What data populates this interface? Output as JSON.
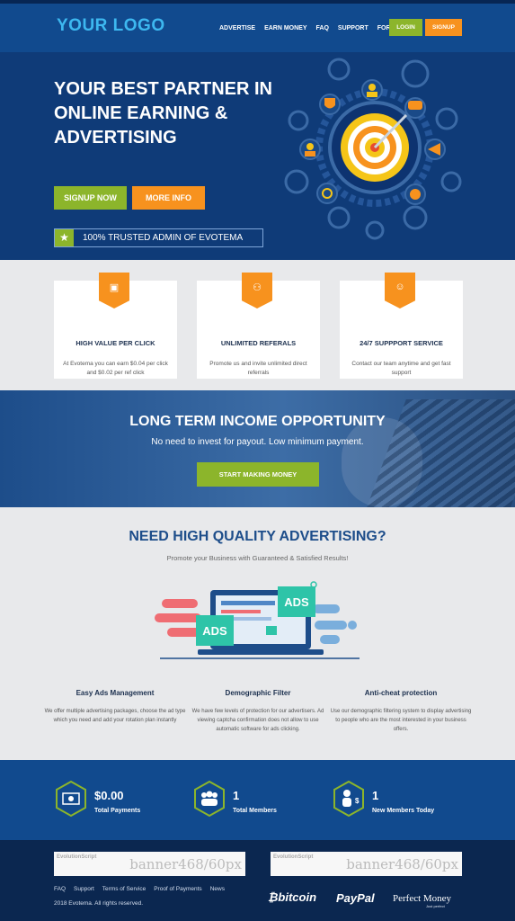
{
  "header": {
    "logo": "YOUR LOGO",
    "nav": [
      "ADVERTISE",
      "EARN MONEY",
      "FAQ",
      "SUPPORT",
      "FORUM"
    ],
    "login": "LOGIN",
    "signup": "SIGNUP"
  },
  "hero": {
    "title": "YOUR BEST PARTNER IN ONLINE EARNING & ADVERTISING",
    "signup_now": "SIGNUP NOW",
    "more_info": "MORE INFO",
    "trusted": "100% TRUSTED ADMIN OF EVOTEMA"
  },
  "features": [
    {
      "icon": "money-icon",
      "title": "HIGH VALUE PER CLICK",
      "desc": "At Evotema you can earn $0.04 per click and $0.02 per ref click"
    },
    {
      "icon": "group-icon",
      "title": "UNLIMITED REFERALS",
      "desc": "Promote us and invite unlimited direct referrals"
    },
    {
      "icon": "support-icon",
      "title": "24/7 SUPPPORT SERVICE",
      "desc": "Contact our team anytime and get fast support"
    }
  ],
  "income": {
    "title": "LONG TERM INCOME OPPORTUNITY",
    "subtitle": "No need to invest for payout. Low minimum payment.",
    "button": "START MAKING MONEY"
  },
  "advertising": {
    "title": "NEED HIGH QUALITY ADVERTISING?",
    "subtitle": "Promote your Business with Guaranteed & Satisfied Results!",
    "ads_label": "ADS",
    "columns": [
      {
        "title": "Easy Ads Management",
        "desc": "We offer multiple advertising packages, choose the ad type which you need and add your rotation plan instantly"
      },
      {
        "title": "Demographic Filter",
        "desc": "We have few levels of protection for our advertisers. Ad viewing captcha confirmation does not allow to use automatic software for ads clicking."
      },
      {
        "title": "Anti-cheat protection",
        "desc": "Use our demographic filtering system to display advertising to people who are the most interested in your business offers."
      }
    ]
  },
  "stats": [
    {
      "icon": "payments-icon",
      "value": "$0.00",
      "label": "Total Payments"
    },
    {
      "icon": "members-icon",
      "value": "1",
      "label": "Total Members"
    },
    {
      "icon": "new-member-icon",
      "value": "1",
      "label": "New Members Today"
    }
  ],
  "footer": {
    "banner_script": "EvolutionScript",
    "banner_size": "banner468/60px",
    "links": [
      "FAQ",
      "Support",
      "Terms of Service",
      "Proof of Payments",
      "News"
    ],
    "copyright": "2018 Evotema. All rights reserved.",
    "bitcoin": "bitcoin",
    "paypal": "PayPal",
    "perfect_money": "Perfect Money",
    "perfect_money_sub": "Just perfect"
  },
  "colors": {
    "header_bg": "#114a8e",
    "hero_bg": "#0f3b78",
    "green": "#8cb52b",
    "orange": "#f7921e",
    "logo_blue": "#3db8f0",
    "light_bg": "#e8e9eb"
  }
}
